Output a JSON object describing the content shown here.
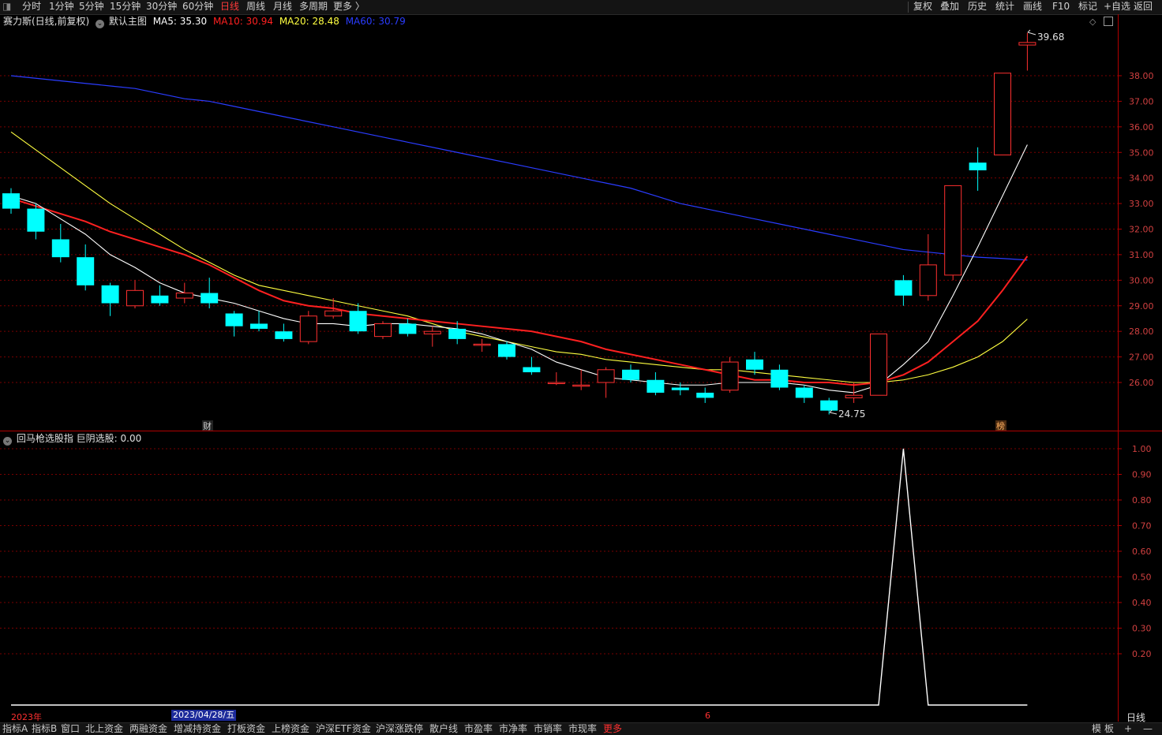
{
  "toolbar": {
    "periods": [
      "分时",
      "1分钟",
      "5分钟",
      "15分钟",
      "30分钟",
      "60分钟",
      "日线",
      "周线",
      "月线",
      "多周期",
      "更多 〉"
    ],
    "active_period": "日线",
    "right_tools": [
      "复权",
      "叠加",
      "历史",
      "统计",
      "画线",
      "F10",
      "标记",
      "+自选",
      "返回"
    ]
  },
  "main_chart": {
    "stock_title": "赛力斯(日线,前复权)",
    "template_label": "默认主图",
    "ma_labels": [
      {
        "text": "MA5: 35.30",
        "color": "#ffffff"
      },
      {
        "text": "MA10: 30.94",
        "color": "#ff2020"
      },
      {
        "text": "MA20: 28.48",
        "color": "#ffff40"
      },
      {
        "text": "MA60: 30.79",
        "color": "#2a3cff"
      }
    ],
    "high_label": "39.68",
    "low_label": "24.75",
    "event_marks": [
      "财",
      "榜"
    ],
    "price_axis": [
      "38.00",
      "37.00",
      "36.00",
      "35.00",
      "34.00",
      "33.00",
      "32.00",
      "31.00",
      "30.00",
      "29.00",
      "28.00",
      "27.00",
      "26.00"
    ]
  },
  "indicator_chart": {
    "title": "回马枪选股指 巨阴选股: 0.00",
    "axis": [
      "1.00",
      "0.90",
      "0.80",
      "0.70",
      "0.60",
      "0.50",
      "0.40",
      "0.30",
      "0.20"
    ]
  },
  "date_bar": {
    "year_label": "2023年",
    "cursor_date": "2023/04/28/五",
    "month_mark": "6",
    "period_label": "日线"
  },
  "bottom_tabs": [
    "指标A",
    "指标B",
    "窗口",
    "北上资金",
    "两融资金",
    "增减持资金",
    "打板资金",
    "上榜资金",
    "沪深ETF资金",
    "沪深涨跌停",
    "散户线",
    "市盈率",
    "市净率",
    "市销率",
    "市现率",
    "更多"
  ],
  "bottom_right": [
    "模",
    "板",
    "+",
    "—"
  ],
  "colors": {
    "up": "#ff3030",
    "down": "#00ffff",
    "ma5": "#ffffff",
    "ma10": "#ff2020",
    "ma20": "#ffff40",
    "ma60": "#2a3cff",
    "grid": "#7a0000"
  },
  "chart_data": {
    "type": "candlestick",
    "candles": [
      {
        "o": 33.4,
        "c": 32.8,
        "h": 33.6,
        "l": 32.6
      },
      {
        "o": 32.8,
        "c": 31.9,
        "h": 33.0,
        "l": 31.6
      },
      {
        "o": 31.6,
        "c": 30.9,
        "h": 32.2,
        "l": 30.7
      },
      {
        "o": 30.9,
        "c": 29.8,
        "h": 31.4,
        "l": 29.6
      },
      {
        "o": 29.8,
        "c": 29.1,
        "h": 29.9,
        "l": 28.6
      },
      {
        "o": 29.0,
        "c": 29.6,
        "h": 30.0,
        "l": 28.9
      },
      {
        "o": 29.4,
        "c": 29.1,
        "h": 29.8,
        "l": 29.0
      },
      {
        "o": 29.3,
        "c": 29.5,
        "h": 29.9,
        "l": 29.1
      },
      {
        "o": 29.5,
        "c": 29.1,
        "h": 30.1,
        "l": 28.9
      },
      {
        "o": 28.7,
        "c": 28.2,
        "h": 28.8,
        "l": 27.8
      },
      {
        "o": 28.3,
        "c": 28.1,
        "h": 28.8,
        "l": 28.0
      },
      {
        "o": 28.0,
        "c": 27.7,
        "h": 28.3,
        "l": 27.6
      },
      {
        "o": 27.6,
        "c": 28.6,
        "h": 28.8,
        "l": 27.5
      },
      {
        "o": 28.6,
        "c": 28.8,
        "h": 29.3,
        "l": 28.5
      },
      {
        "o": 28.8,
        "c": 28.0,
        "h": 29.1,
        "l": 27.9
      },
      {
        "o": 27.8,
        "c": 28.3,
        "h": 28.4,
        "l": 27.7
      },
      {
        "o": 28.3,
        "c": 27.9,
        "h": 28.5,
        "l": 27.8
      },
      {
        "o": 27.9,
        "c": 28.0,
        "h": 28.2,
        "l": 27.4
      },
      {
        "o": 28.1,
        "c": 27.7,
        "h": 28.4,
        "l": 27.5
      },
      {
        "o": 27.5,
        "c": 27.5,
        "h": 27.7,
        "l": 27.2
      },
      {
        "o": 27.5,
        "c": 27.0,
        "h": 27.6,
        "l": 26.9
      },
      {
        "o": 26.6,
        "c": 26.4,
        "h": 27.0,
        "l": 26.3
      },
      {
        "o": 26.0,
        "c": 26.0,
        "h": 26.4,
        "l": 25.9
      },
      {
        "o": 25.9,
        "c": 25.9,
        "h": 26.5,
        "l": 25.7
      },
      {
        "o": 26.0,
        "c": 26.5,
        "h": 26.6,
        "l": 25.4
      },
      {
        "o": 26.5,
        "c": 26.1,
        "h": 26.7,
        "l": 26.0
      },
      {
        "o": 26.1,
        "c": 25.6,
        "h": 26.4,
        "l": 25.5
      },
      {
        "o": 25.8,
        "c": 25.7,
        "h": 26.0,
        "l": 25.5
      },
      {
        "o": 25.6,
        "c": 25.4,
        "h": 25.8,
        "l": 25.2
      },
      {
        "o": 25.7,
        "c": 26.8,
        "h": 27.0,
        "l": 25.6
      },
      {
        "o": 26.9,
        "c": 26.5,
        "h": 27.2,
        "l": 26.3
      },
      {
        "o": 26.5,
        "c": 25.8,
        "h": 26.7,
        "l": 25.7
      },
      {
        "o": 25.8,
        "c": 25.4,
        "h": 25.9,
        "l": 25.2
      },
      {
        "o": 25.3,
        "c": 24.9,
        "h": 25.4,
        "l": 24.75
      },
      {
        "o": 25.4,
        "c": 25.5,
        "h": 26.0,
        "l": 25.2
      },
      {
        "o": 25.5,
        "c": 27.9,
        "h": 27.9,
        "l": 25.5
      },
      {
        "o": 30.0,
        "c": 29.4,
        "h": 30.2,
        "l": 29.0
      },
      {
        "o": 29.4,
        "c": 30.6,
        "h": 31.8,
        "l": 29.2
      },
      {
        "o": 30.2,
        "c": 33.7,
        "h": 33.7,
        "l": 30.0
      },
      {
        "o": 34.6,
        "c": 34.3,
        "h": 35.2,
        "l": 33.5
      },
      {
        "o": 34.9,
        "c": 38.1,
        "h": 38.1,
        "l": 34.9
      },
      {
        "o": 39.2,
        "c": 39.3,
        "h": 39.68,
        "l": 38.2
      }
    ],
    "ma5": [
      33.3,
      33.0,
      32.4,
      31.8,
      31.0,
      30.5,
      29.9,
      29.5,
      29.3,
      29.1,
      28.8,
      28.5,
      28.3,
      28.3,
      28.2,
      28.3,
      28.3,
      28.2,
      28.1,
      27.9,
      27.6,
      27.3,
      26.8,
      26.5,
      26.2,
      26.1,
      26.0,
      25.9,
      25.9,
      26.0,
      26.0,
      26.0,
      25.9,
      25.7,
      25.6,
      25.9,
      26.7,
      27.6,
      29.4,
      31.3,
      33.3,
      35.3
    ],
    "ma10": [
      33.2,
      32.9,
      32.6,
      32.3,
      31.9,
      31.6,
      31.3,
      31.0,
      30.6,
      30.1,
      29.6,
      29.2,
      29.0,
      28.9,
      28.7,
      28.6,
      28.5,
      28.4,
      28.3,
      28.2,
      28.1,
      28.0,
      27.8,
      27.6,
      27.3,
      27.1,
      26.9,
      26.7,
      26.5,
      26.3,
      26.1,
      26.1,
      26.0,
      26.0,
      25.9,
      26.0,
      26.3,
      26.8,
      27.6,
      28.4,
      29.6,
      30.94
    ],
    "ma20": [
      35.8,
      35.1,
      34.4,
      33.7,
      33.0,
      32.4,
      31.8,
      31.2,
      30.7,
      30.2,
      29.8,
      29.6,
      29.4,
      29.2,
      29.0,
      28.8,
      28.6,
      28.3,
      28.0,
      27.8,
      27.6,
      27.4,
      27.2,
      27.1,
      26.9,
      26.8,
      26.7,
      26.6,
      26.5,
      26.5,
      26.4,
      26.3,
      26.2,
      26.1,
      26.0,
      26.0,
      26.1,
      26.3,
      26.6,
      27.0,
      27.6,
      28.48
    ],
    "ma60": [
      38.0,
      37.9,
      37.8,
      37.7,
      37.6,
      37.5,
      37.3,
      37.1,
      37.0,
      36.8,
      36.6,
      36.4,
      36.2,
      36.0,
      35.8,
      35.6,
      35.4,
      35.2,
      35.0,
      34.8,
      34.6,
      34.4,
      34.2,
      34.0,
      33.8,
      33.6,
      33.3,
      33.0,
      32.8,
      32.6,
      32.4,
      32.2,
      32.0,
      31.8,
      31.6,
      31.4,
      31.2,
      31.1,
      31.0,
      30.9,
      30.85,
      30.79
    ],
    "y_range": [
      24.6,
      39.9
    ],
    "indicator": {
      "name": "巨阴选股",
      "values": [
        0,
        0,
        0,
        0,
        0,
        0,
        0,
        0,
        0,
        0,
        0,
        0,
        0,
        0,
        0,
        0,
        0,
        0,
        0,
        0,
        0,
        0,
        0,
        0,
        0,
        0,
        0,
        0,
        0,
        0,
        0,
        0,
        0,
        0,
        0,
        0,
        1,
        0,
        0,
        0,
        0,
        0
      ],
      "y_range": [
        0,
        1
      ]
    }
  }
}
